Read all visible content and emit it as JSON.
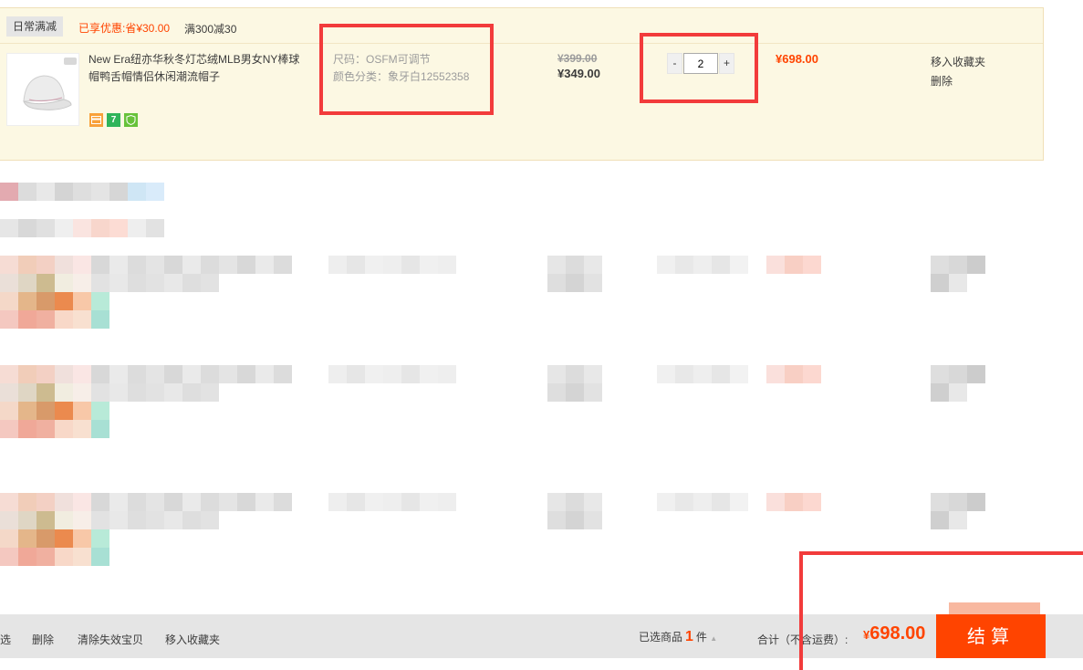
{
  "promo": {
    "tag": "日常满减",
    "saved": "已享优惠:省¥30.00",
    "rule": "满300减30"
  },
  "item": {
    "title": "New Era纽亦华秋冬灯芯绒MLB男女NY棒球帽鸭舌帽情侣休闲潮流帽子",
    "sku_size": "尺码：OSFM可调节",
    "sku_color": "颜色分类：象牙白12552358",
    "price_original": "¥399.00",
    "price_current": "¥349.00",
    "qty_minus": "-",
    "qty_value": "2",
    "qty_plus": "+",
    "subtotal": "¥698.00",
    "op_favorite": "移入收藏夹",
    "op_delete": "删除",
    "badges": [
      "card-icon",
      "seven-day-return-icon",
      "shield-icon"
    ]
  },
  "footer": {
    "link_cut": "选",
    "delete": "删除",
    "clear_invalid": "清除失效宝贝",
    "move_favorites": "移入收藏夹",
    "selected_prefix": "已选商品",
    "selected_count": "1",
    "selected_suffix": "件",
    "total_label": "合计（不含运费）:",
    "total_currency": "¥",
    "total_amount": "698.00",
    "checkout": "结算"
  },
  "colors": {
    "accent": "#ff4400",
    "cart_bg": "#fcf8e3",
    "annotation": "#f23b3b",
    "footer_bg": "#e5e5e5"
  }
}
